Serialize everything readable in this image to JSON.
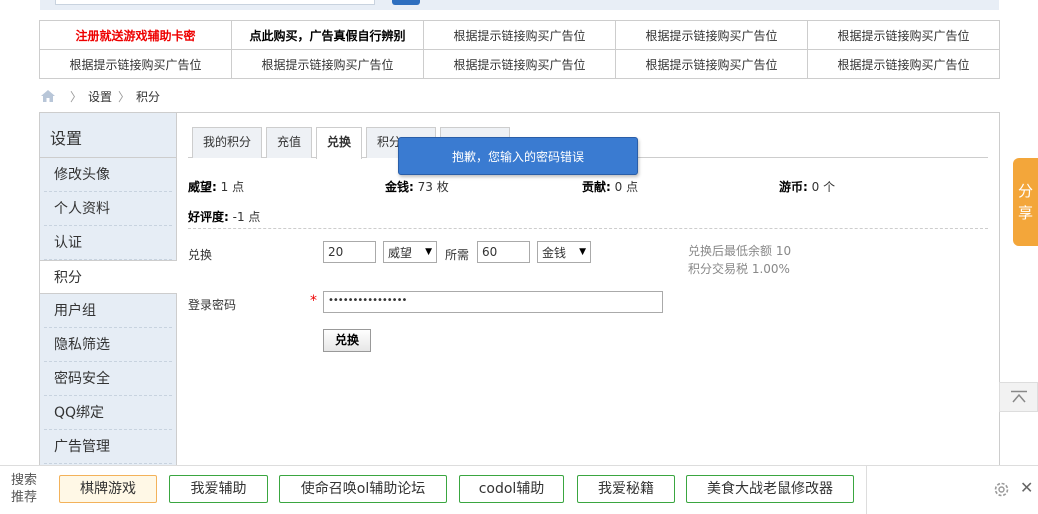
{
  "ads": [
    [
      "注册就送游戏辅助卡密",
      "点此购买，广告真假自行辨别",
      "根据提示链接购买广告位",
      "根据提示链接购买广告位",
      "根据提示链接购买广告位"
    ],
    [
      "根据提示链接购买广告位",
      "根据提示链接购买广告位",
      "根据提示链接购买广告位",
      "根据提示链接购买广告位",
      "根据提示链接购买广告位"
    ]
  ],
  "breadcrumb": {
    "items": [
      "设置",
      "积分"
    ]
  },
  "sidebar": {
    "title": "设置",
    "items": [
      "修改头像",
      "个人资料",
      "认证",
      "积分",
      "用户组",
      "隐私筛选",
      "密码安全",
      "QQ绑定",
      "广告管理"
    ],
    "active": "积分"
  },
  "tabs": [
    "我的积分",
    "充值",
    "兑换",
    "积分"
  ],
  "active_tab": "兑换",
  "stats": {
    "weiwang_label": "威望:",
    "weiwang_value": "1 点",
    "jinqian_label": "金钱:",
    "jinqian_value": "73 枚",
    "gongxian_label": "贡献:",
    "gongxian_value": "0 点",
    "youbi_label": "游币:",
    "youbi_value": "0 个",
    "haoping_label": "好评度:",
    "haoping_value": "-1 点"
  },
  "form": {
    "exchange_label": "兑换",
    "exchange_amount": "20",
    "exchange_unit": "威望",
    "need_label": "所需",
    "need_amount": "60",
    "need_unit": "金钱",
    "note_line1": "兑换后最低余额 10",
    "note_line2": "积分交易税 1.00%",
    "password_label": "登录密码",
    "password_value": "••••••••••••••••",
    "required_mark": "*",
    "submit_label": "兑换"
  },
  "toast": "抱歉，您输入的密码错误",
  "share_label": [
    "分",
    "享"
  ],
  "search_bar": {
    "tag": [
      "搜索",
      "推荐"
    ],
    "chips": [
      "棋牌游戏",
      "我爱辅助",
      "使命召唤ol辅助论坛",
      "codol辅助",
      "我爱秘籍",
      "美食大战老鼠修改器"
    ]
  },
  "colors": {
    "accent": "#3a7bd1",
    "share": "#f3a63a",
    "sidebar": "#e6edf5",
    "chip_border": "#3aa640"
  }
}
